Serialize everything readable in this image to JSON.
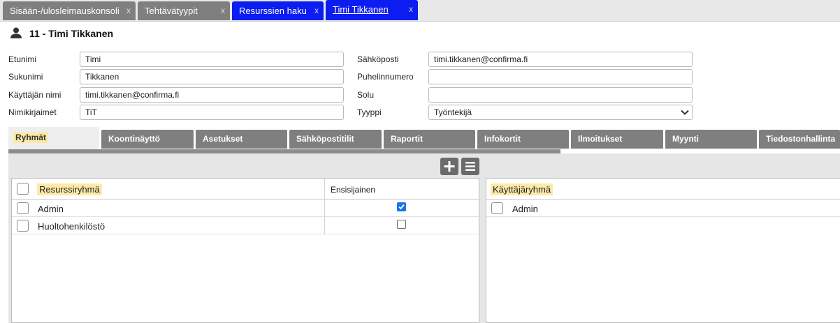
{
  "window_tabs": [
    {
      "label": "Sisään-/ulosleimauskonsoli",
      "close": "x"
    },
    {
      "label": "Tehtävätyypit",
      "close": "x"
    },
    {
      "label": "Resurssien haku",
      "close": "x"
    },
    {
      "label": "Timi Tikkanen",
      "close": "x"
    }
  ],
  "page": {
    "title": "11 - Timi Tikkanen",
    "icon": "person-icon"
  },
  "form": {
    "first_name_label": "Etunimi",
    "first_name": "Timi",
    "last_name_label": "Sukunimi",
    "last_name": "Tikkanen",
    "username_label": "Käyttäjän nimi",
    "username": "timi.tikkanen@confirma.fi",
    "initials_label": "Nimikirjaimet",
    "initials": "TiT",
    "email_label": "Sähköposti",
    "email": "timi.tikkanen@confirma.fi",
    "phone_label": "Puhelinnumero",
    "phone": "",
    "cell_label": "Solu",
    "cell": "",
    "type_label": "Tyyppi",
    "type": "Työntekijä"
  },
  "inner_tabs": [
    "Ryhmät",
    "Koontinäyttö",
    "Asetukset",
    "Sähköpostitilit",
    "Raportit",
    "Infokortit",
    "Ilmoitukset",
    "Myynti",
    "Tiedostonhallinta"
  ],
  "toolbar": {
    "add_icon": "plus-icon",
    "menu_icon": "list-icon"
  },
  "resource_groups": {
    "header_name": "Resurssiryhmä",
    "header_primary": "Ensisijainen",
    "rows": [
      {
        "name": "Admin",
        "primary": true
      },
      {
        "name": "Huoltohenkilöstö",
        "primary": false
      }
    ]
  },
  "user_groups": {
    "header_name": "Käyttäjäryhmä",
    "rows": [
      {
        "name": "Admin"
      }
    ]
  },
  "colors": {
    "tab_blue": "#0b1df0",
    "tab_gray": "#7f7f7f",
    "highlight": "#fde9a8",
    "check_blue": "#1a73e8"
  }
}
